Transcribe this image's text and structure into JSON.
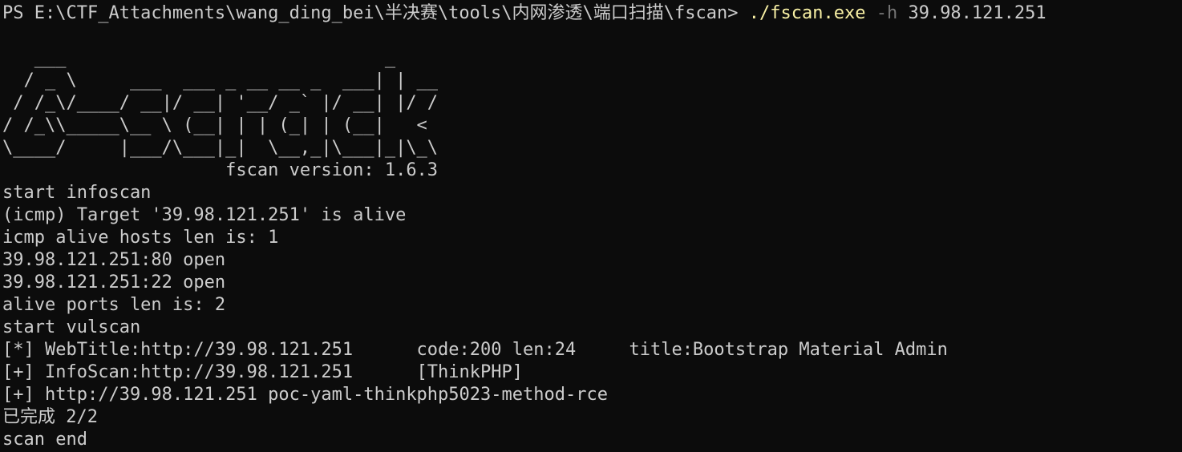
{
  "prompt": {
    "text": "PS E:\\CTF_Attachments\\wang_ding_bei\\半决赛\\tools\\内网渗透\\端口扫描\\fscan> ",
    "command": "./fscan.exe",
    "flag": "-h",
    "argument": "39.98.121.251"
  },
  "banner": [
    "   ___                              _",
    "  / _ \\     ___  ___ _ __ __ _  ___| | __",
    " / /_\\/____/ __|/ __| '__/ _` |/ __| |/ /",
    "/ /_\\\\_____\\__ \\ (__| | | (_| | (__|   <",
    "\\____/     |___/\\___|_|  \\__,_|\\___|_|\\_\\",
    "                     fscan version: 1.6.3"
  ],
  "output": [
    "start infoscan",
    "(icmp) Target '39.98.121.251' is alive",
    "icmp alive hosts len is: 1",
    "39.98.121.251:80 open",
    "39.98.121.251:22 open",
    "alive ports len is: 2",
    "start vulscan",
    "[*] WebTitle:http://39.98.121.251      code:200 len:24     title:Bootstrap Material Admin",
    "[+] InfoScan:http://39.98.121.251      [ThinkPHP]",
    "[+] http://39.98.121.251 poc-yaml-thinkphp5023-method-rce",
    "已完成 2/2",
    "scan end"
  ],
  "colors": {
    "background": "#0c0c0c",
    "foreground": "#cccccc",
    "command": "#f9f1a5",
    "flag": "#767676"
  }
}
